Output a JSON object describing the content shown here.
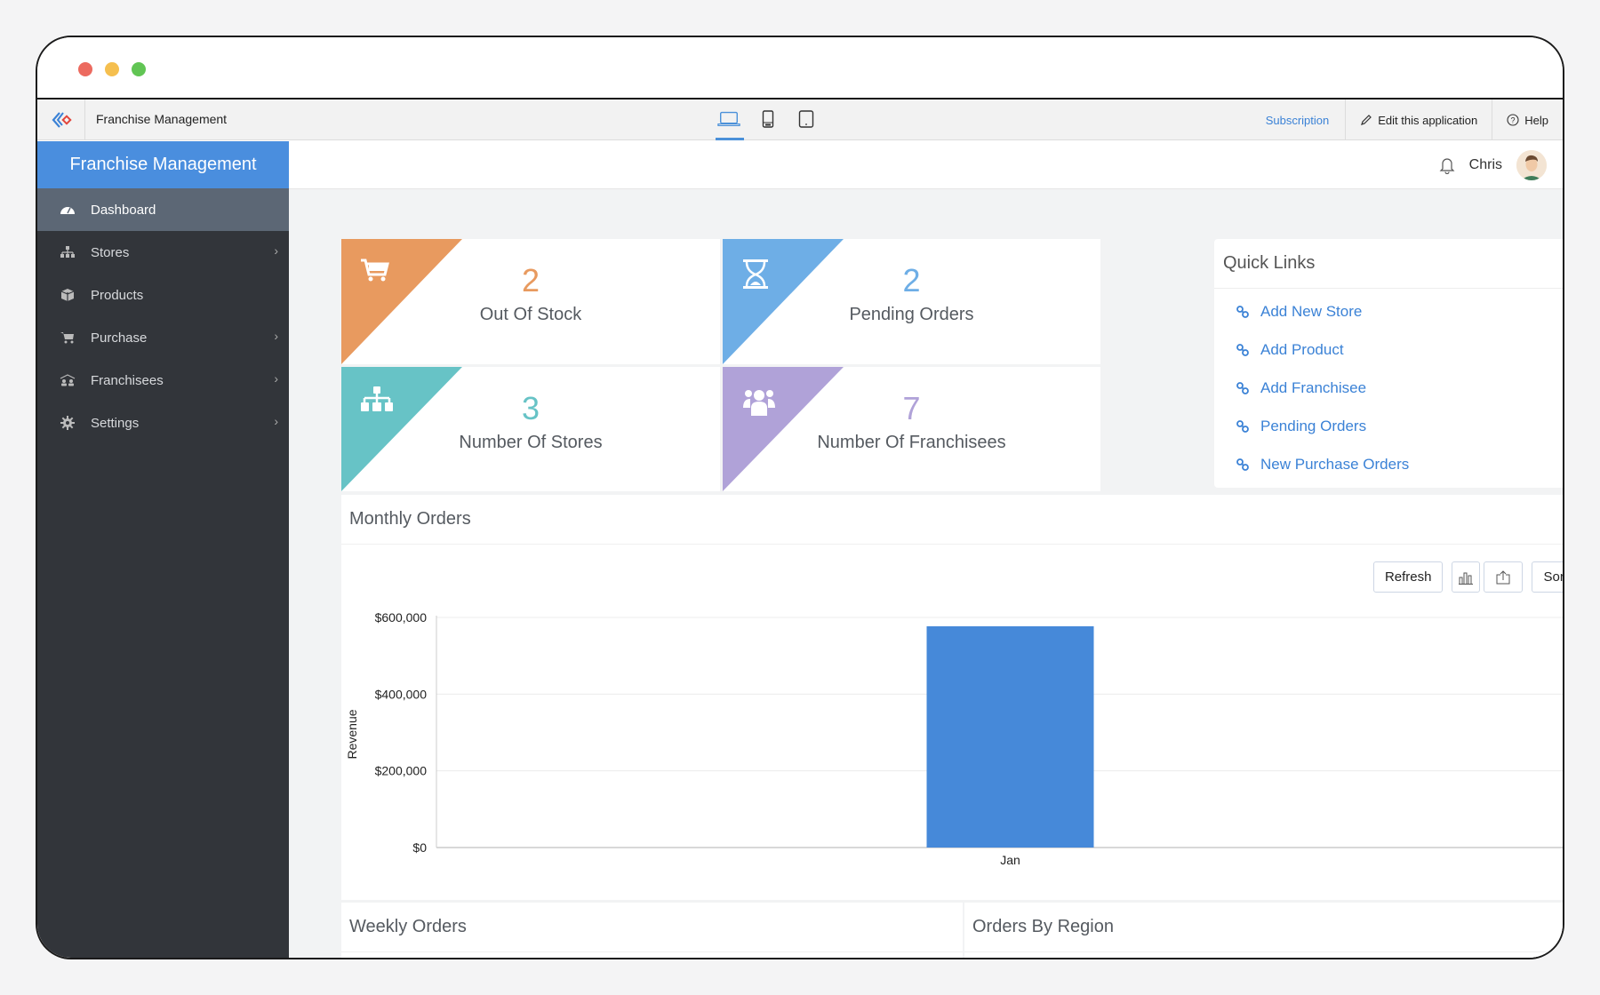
{
  "window": {
    "controls": [
      "close",
      "minimize",
      "maximize"
    ]
  },
  "appbar": {
    "app_title": "Franchise Management",
    "devices": [
      "laptop-icon",
      "phone-icon",
      "tablet-icon"
    ],
    "active_device": "laptop",
    "subscription": "Subscription",
    "edit": "Edit this application",
    "help": "Help"
  },
  "sidebar": {
    "title": "Franchise Management",
    "items": [
      {
        "label": "Dashboard",
        "icon": "dashboard-icon",
        "active": true,
        "has_children": false
      },
      {
        "label": "Stores",
        "icon": "sitemap-icon",
        "active": false,
        "has_children": true
      },
      {
        "label": "Products",
        "icon": "box-icon",
        "active": false,
        "has_children": false
      },
      {
        "label": "Purchase",
        "icon": "cart-icon",
        "active": false,
        "has_children": true
      },
      {
        "label": "Franchisees",
        "icon": "users-icon",
        "active": false,
        "has_children": true
      },
      {
        "label": "Settings",
        "icon": "gear-icon",
        "active": false,
        "has_children": true
      }
    ]
  },
  "header": {
    "user_name": "Chris"
  },
  "stats": [
    {
      "value": "2",
      "label": "Out Of Stock",
      "icon": "cart-icon",
      "color": "#e89a5f"
    },
    {
      "value": "2",
      "label": "Pending Orders",
      "icon": "hourglass-icon",
      "color": "#6eaee6"
    },
    {
      "value": "3",
      "label": "Number Of Stores",
      "icon": "sitemap-icon",
      "color": "#67c3c6"
    },
    {
      "value": "7",
      "label": "Number Of Franchisees",
      "icon": "users-icon",
      "color": "#b0a2d8"
    }
  ],
  "quick_links": {
    "title": "Quick Links",
    "items": [
      "Add New Store",
      "Add Product",
      "Add Franchisee",
      "Pending Orders",
      "New Purchase Orders"
    ]
  },
  "panels": {
    "monthly": {
      "title": "Monthly Orders"
    },
    "weekly": {
      "title": "Weekly Orders"
    },
    "region": {
      "title": "Orders By Region"
    }
  },
  "toolbar": {
    "refresh": "Refresh",
    "sort": "Sort"
  },
  "chart_data": {
    "type": "bar",
    "title": "Monthly Orders",
    "categories": [
      "Jan"
    ],
    "values": [
      577000
    ],
    "xlabel": "",
    "ylabel": "Revenue",
    "ylim": [
      0,
      600000
    ],
    "yticks": [
      0,
      200000,
      400000,
      600000
    ],
    "ytick_labels": [
      "$0",
      "$200,000",
      "$400,000",
      "$600,000"
    ],
    "grid": true,
    "color": "#4689d9"
  }
}
